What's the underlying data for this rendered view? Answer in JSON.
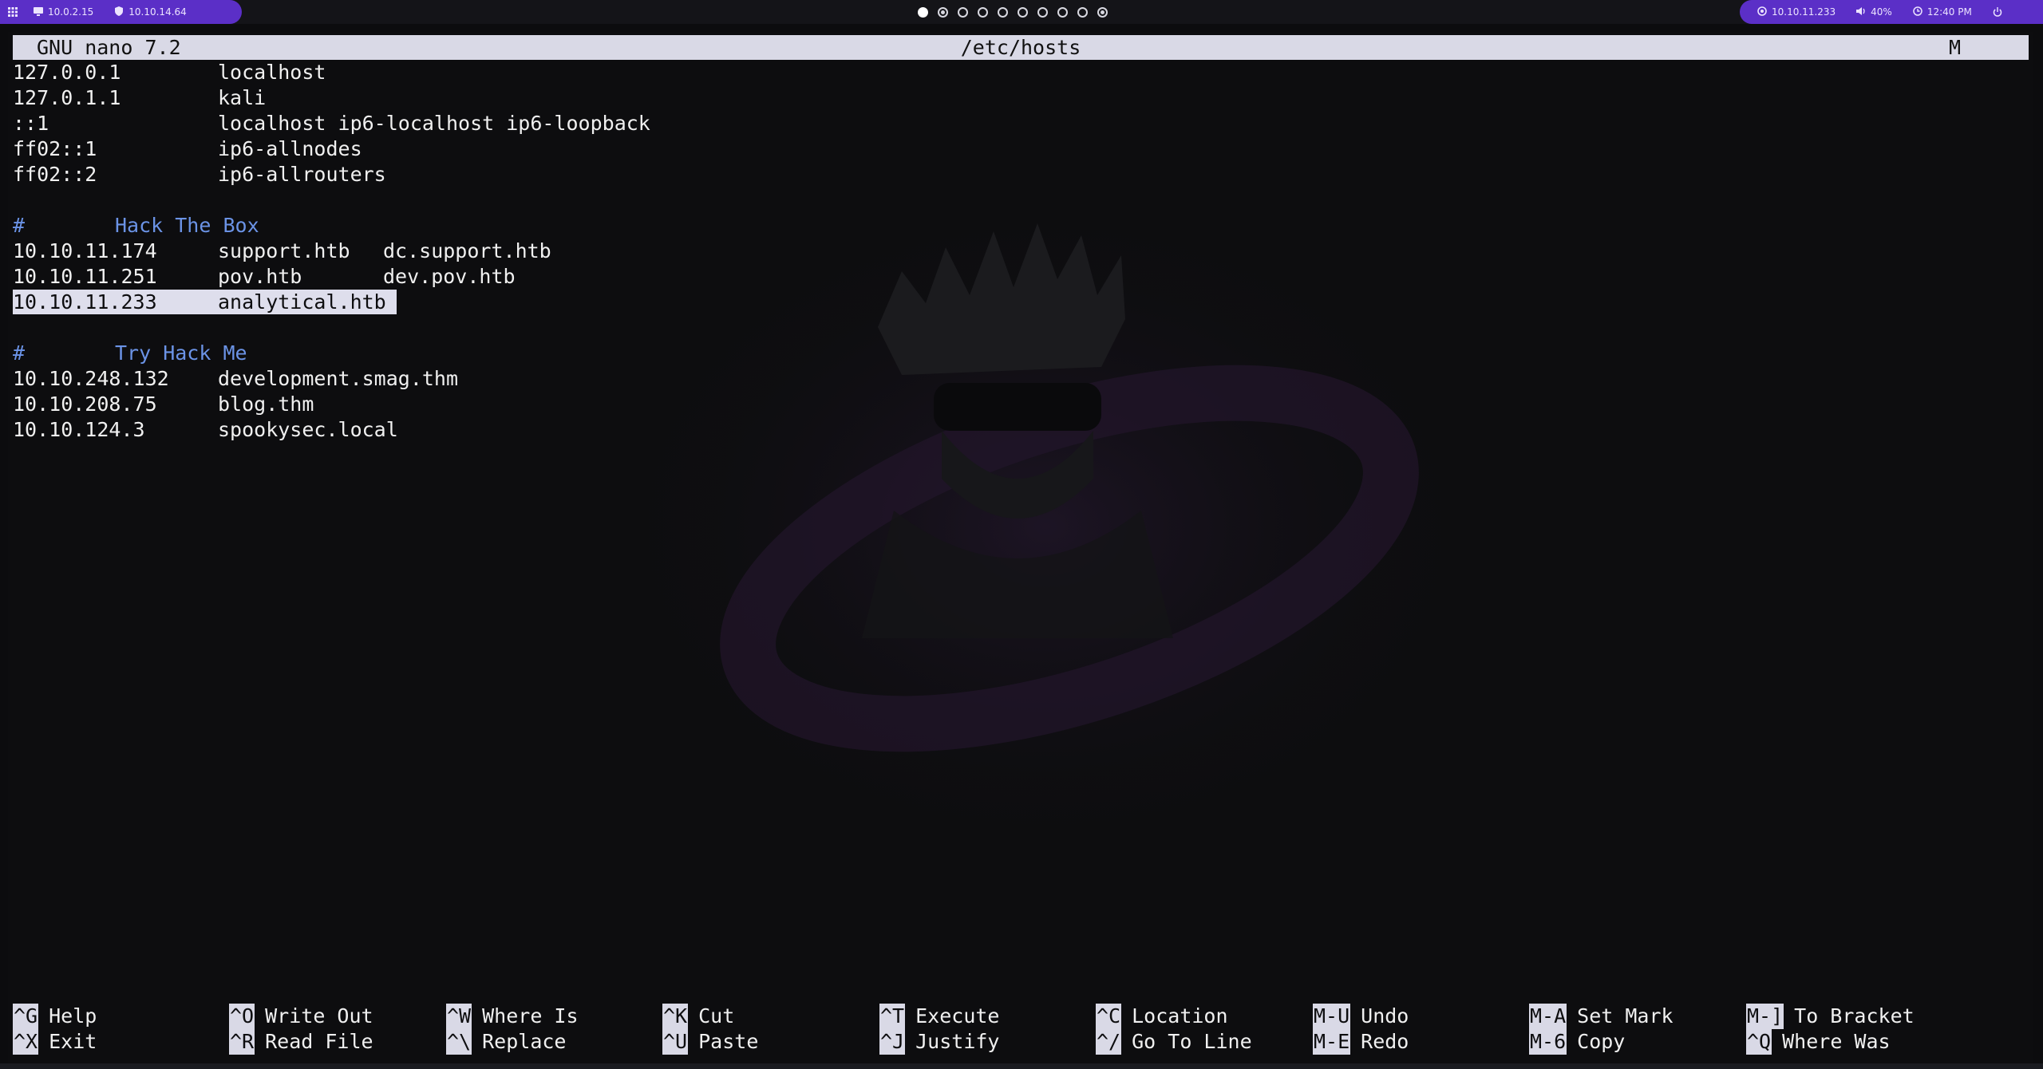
{
  "topbar": {
    "left": [
      {
        "icon": "monitor-icon",
        "text": "10.0.2.15"
      },
      {
        "icon": "shield-icon",
        "text": "10.10.14.64"
      }
    ],
    "workspaces": 10,
    "active_workspace": 1,
    "right": [
      {
        "icon": "target-icon",
        "text": "10.10.11.233"
      },
      {
        "icon": "volume-icon",
        "text": "40%"
      },
      {
        "icon": "clock-icon",
        "text": "12:40 PM"
      }
    ],
    "accent": "#5b2fc7"
  },
  "nano": {
    "version": "GNU nano 7.2",
    "filename": "/etc/hosts",
    "modified": "M",
    "lines": [
      {
        "ip": "127.0.0.1",
        "host": "localhost",
        "alias": ""
      },
      {
        "ip": "127.0.1.1",
        "host": "kali",
        "alias": ""
      },
      {
        "ip": "::1",
        "host": "localhost ip6-localhost ip6-loopback",
        "alias": ""
      },
      {
        "ip": "ff02::1",
        "host": "ip6-allnodes",
        "alias": ""
      },
      {
        "ip": "ff02::2",
        "host": "ip6-allrouters",
        "alias": ""
      },
      {
        "blank": true
      },
      {
        "comment": "Hack The Box"
      },
      {
        "ip": "10.10.11.174",
        "host": "support.htb",
        "alias": "dc.support.htb"
      },
      {
        "ip": "10.10.11.251",
        "host": "pov.htb",
        "alias": "dev.pov.htb"
      },
      {
        "ip": "10.10.11.233",
        "host": "analytical.htb",
        "alias": "",
        "selected": true
      },
      {
        "blank": true
      },
      {
        "comment": "Try Hack Me"
      },
      {
        "ip": "10.10.248.132",
        "host": "development.smag.thm",
        "alias": ""
      },
      {
        "ip": "10.10.208.75",
        "host": "blog.thm",
        "alias": ""
      },
      {
        "ip": "10.10.124.3",
        "host": "spookysec.local",
        "alias": ""
      }
    ],
    "shortcuts": [
      [
        {
          "key": "^G",
          "label": "Help"
        },
        {
          "key": "^X",
          "label": "Exit"
        }
      ],
      [
        {
          "key": "^O",
          "label": "Write Out"
        },
        {
          "key": "^R",
          "label": "Read File"
        }
      ],
      [
        {
          "key": "^W",
          "label": "Where Is"
        },
        {
          "key": "^\\",
          "label": "Replace"
        }
      ],
      [
        {
          "key": "^K",
          "label": "Cut"
        },
        {
          "key": "^U",
          "label": "Paste"
        }
      ],
      [
        {
          "key": "^T",
          "label": "Execute"
        },
        {
          "key": "^J",
          "label": "Justify"
        }
      ],
      [
        {
          "key": "^C",
          "label": "Location"
        },
        {
          "key": "^/",
          "label": "Go To Line"
        }
      ],
      [
        {
          "key": "M-U",
          "label": "Undo"
        },
        {
          "key": "M-E",
          "label": "Redo"
        }
      ],
      [
        {
          "key": "M-A",
          "label": "Set Mark"
        },
        {
          "key": "M-6",
          "label": "Copy"
        }
      ],
      [
        {
          "key": "M-]",
          "label": "To Bracket"
        },
        {
          "key": "^Q",
          "label": "Where Was"
        }
      ]
    ],
    "comment_color": "#6b93e6",
    "selection_color": "#dedeec"
  }
}
